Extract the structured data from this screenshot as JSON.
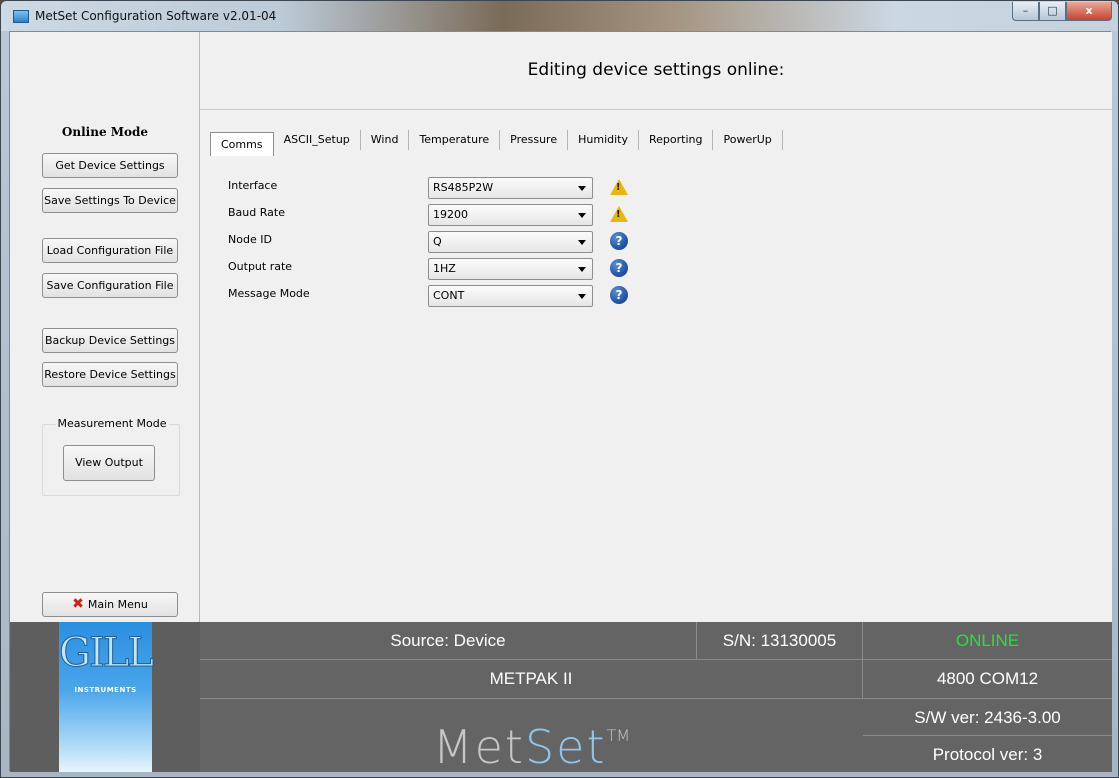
{
  "window": {
    "title": "MetSet Configuration Software v2.01-04",
    "minimize": "–",
    "maximize": "□",
    "close": "x"
  },
  "sidebar": {
    "heading": "Online Mode",
    "buttons": {
      "get_settings": "Get Device Settings",
      "save_to_device": "Save Settings To Device",
      "load_config": "Load Configuration File",
      "save_config": "Save Configuration File",
      "backup": "Backup Device Settings",
      "restore": "Restore Device Settings"
    },
    "measurement_group": {
      "label": "Measurement Mode",
      "view_output": "View Output"
    },
    "main_menu": "Main Menu",
    "main_menu_icon": "red-x-icon"
  },
  "main": {
    "title": "Editing device settings online:",
    "tabs": [
      "Comms",
      "ASCII_Setup",
      "Wind",
      "Temperature",
      "Pressure",
      "Humidity",
      "Reporting",
      "PowerUp"
    ],
    "active_tab": "Comms",
    "fields": [
      {
        "label": "Interface",
        "value": "RS485P2W",
        "icon": "warning-icon"
      },
      {
        "label": "Baud Rate",
        "value": "19200",
        "icon": "warning-icon"
      },
      {
        "label": "Node ID",
        "value": "Q",
        "icon": "help-icon"
      },
      {
        "label": "Output rate",
        "value": "1HZ",
        "icon": "help-icon"
      },
      {
        "label": "Message Mode",
        "value": "CONT",
        "icon": "help-icon"
      }
    ]
  },
  "status": {
    "logo_text": "GILL",
    "logo_sub": "INSTRUMENTS",
    "source": "Source: Device",
    "serial": "S/N: 13130005",
    "connection": "ONLINE",
    "connection_color": "#22e43a",
    "device": "METPAK II",
    "port": "4800 COM12",
    "sw_version": "S/W ver: 2436-3.00",
    "protocol": "Protocol ver: 3",
    "brand_met": "Met",
    "brand_set": "Set",
    "brand_tm": "TM"
  }
}
